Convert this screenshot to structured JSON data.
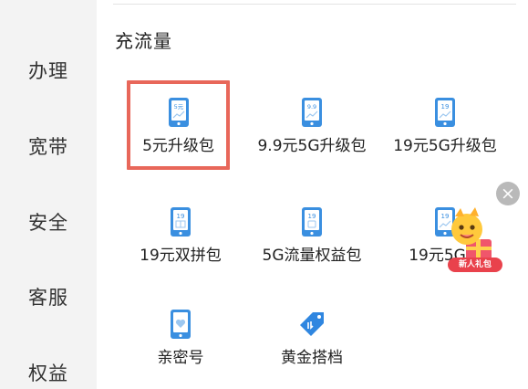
{
  "sidebar": {
    "items": [
      {
        "label": "办理"
      },
      {
        "label": "宽带"
      },
      {
        "label": "安全"
      },
      {
        "label": "客服"
      },
      {
        "label": "权益"
      }
    ]
  },
  "section": {
    "title": "充流量",
    "tiles": [
      {
        "label": "5元升级包",
        "icon_text": "5元",
        "selected": true
      },
      {
        "label": "9.9元5G升级包",
        "icon_text": "9.9"
      },
      {
        "label": "19元5G升级包",
        "icon_text": "19"
      },
      {
        "label": "19元双拼包",
        "icon_text": "19"
      },
      {
        "label": "5G流量权益包",
        "icon_text": "19"
      },
      {
        "label": "19元5G通",
        "icon_text": "19"
      },
      {
        "label": "亲密号",
        "icon": "heart-phone-icon"
      },
      {
        "label": "黄金搭档",
        "icon": "price-tag-icon"
      }
    ]
  },
  "ad": {
    "badge_text": "新人礼包",
    "close_glyph": "×"
  },
  "colors": {
    "accent": "#e8675a",
    "icon_blue": "#3a8fe0",
    "badge_red": "#e9424c"
  }
}
